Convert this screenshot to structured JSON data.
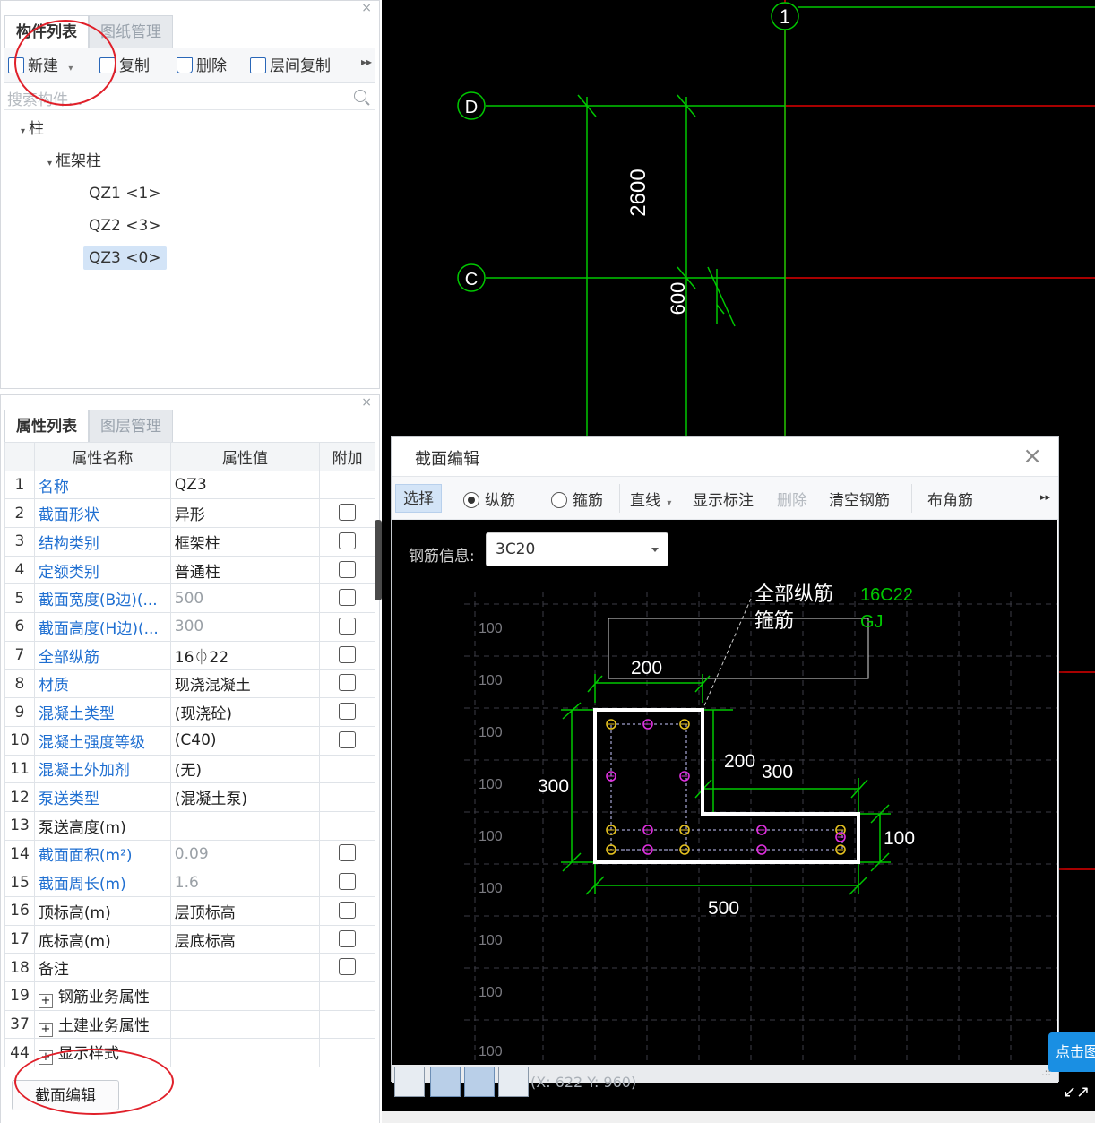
{
  "component_panel": {
    "close_glyph": "×",
    "tabs": [
      "构件列表",
      "图纸管理"
    ],
    "toolbar": {
      "new_label": "新建",
      "new_dropdown": "▾",
      "copy_label": "复制",
      "delete_label": "删除",
      "floor_copy_label": "层间复制",
      "more_glyph": "▸▸"
    },
    "search_placeholder": "搜索构件...",
    "tree": {
      "root": "柱",
      "group": "框架柱",
      "items": [
        "QZ1 <1>",
        "QZ2 <3>",
        "QZ3 <0>"
      ],
      "selected_index": 2
    }
  },
  "property_panel": {
    "close_glyph": "×",
    "tabs": [
      "属性列表",
      "图层管理"
    ],
    "headers": [
      "属性名称",
      "属性值",
      "附加"
    ],
    "rows": [
      {
        "num": "1",
        "name": "名称",
        "value": "QZ3",
        "name_style": "blue",
        "value_style": "normal",
        "checkbox": false
      },
      {
        "num": "2",
        "name": "截面形状",
        "value": "异形",
        "name_style": "blue",
        "value_style": "normal",
        "checkbox": true
      },
      {
        "num": "3",
        "name": "结构类别",
        "value": "框架柱",
        "name_style": "blue",
        "value_style": "normal",
        "checkbox": true
      },
      {
        "num": "4",
        "name": "定额类别",
        "value": "普通柱",
        "name_style": "blue",
        "value_style": "normal",
        "checkbox": true
      },
      {
        "num": "5",
        "name": "截面宽度(B边)(...",
        "value": "500",
        "name_style": "blue",
        "value_style": "grey",
        "checkbox": true
      },
      {
        "num": "6",
        "name": "截面高度(H边)(...",
        "value": "300",
        "name_style": "blue",
        "value_style": "grey",
        "checkbox": true
      },
      {
        "num": "7",
        "name": "全部纵筋",
        "value": "16⏀22",
        "name_style": "blue",
        "value_style": "normal",
        "checkbox": true
      },
      {
        "num": "8",
        "name": "材质",
        "value": "现浇混凝土",
        "name_style": "blue",
        "value_style": "normal",
        "checkbox": true
      },
      {
        "num": "9",
        "name": "混凝土类型",
        "value": "(现浇砼)",
        "name_style": "blue",
        "value_style": "normal",
        "checkbox": true
      },
      {
        "num": "10",
        "name": "混凝土强度等级",
        "value": "(C40)",
        "name_style": "blue",
        "value_style": "normal",
        "checkbox": true
      },
      {
        "num": "11",
        "name": "混凝土外加剂",
        "value": "(无)",
        "name_style": "blue",
        "value_style": "normal",
        "checkbox": false
      },
      {
        "num": "12",
        "name": "泵送类型",
        "value": "(混凝土泵)",
        "name_style": "blue",
        "value_style": "normal",
        "checkbox": false
      },
      {
        "num": "13",
        "name": "泵送高度(m)",
        "value": "",
        "name_style": "normal",
        "value_style": "normal",
        "checkbox": false
      },
      {
        "num": "14",
        "name": "截面面积(m²)",
        "value": "0.09",
        "name_style": "blue",
        "value_style": "grey",
        "checkbox": true
      },
      {
        "num": "15",
        "name": "截面周长(m)",
        "value": "1.6",
        "name_style": "blue",
        "value_style": "grey",
        "checkbox": true
      },
      {
        "num": "16",
        "name": "顶标高(m)",
        "value": "层顶标高",
        "name_style": "normal",
        "value_style": "normal",
        "checkbox": true
      },
      {
        "num": "17",
        "name": "底标高(m)",
        "value": "层底标高",
        "name_style": "normal",
        "value_style": "normal",
        "checkbox": true
      },
      {
        "num": "18",
        "name": "备注",
        "value": "",
        "name_style": "normal",
        "value_style": "normal",
        "checkbox": true
      }
    ],
    "groups": [
      {
        "num": "19",
        "label": "钢筋业务属性"
      },
      {
        "num": "37",
        "label": "土建业务属性"
      },
      {
        "num": "44",
        "label": "显示样式"
      }
    ],
    "section_edit_button": "截面编辑",
    "plus_glyph": "+"
  },
  "cad": {
    "axis_labels": [
      "1",
      "D",
      "C"
    ],
    "dimensions": [
      "2600",
      "600"
    ]
  },
  "dialog": {
    "title": "截面编辑",
    "close_glyph": "×",
    "tools": {
      "select": "选择",
      "longitudinal": "纵筋",
      "stirrup": "箍筋",
      "line": "直线",
      "line_dropdown": "▾",
      "show_dim": "显示标注",
      "delete": "删除",
      "clear": "清空钢筋",
      "corner": "布角筋",
      "more": "▸▸"
    },
    "rebar_info_label": "钢筋信息:",
    "rebar_info_value": "3C20",
    "drawing": {
      "label_all_long": "全部纵筋",
      "label_all_long_value": "16C22",
      "label_stirrup": "箍筋",
      "label_stirrup_value": "GJ",
      "grid_label": "100",
      "dim_top": "200",
      "dim_left": "300",
      "dim_inner_v": "200",
      "dim_inner_h": "300",
      "dim_right": "100",
      "dim_bottom": "500"
    },
    "coordinates": "(X: 622 Y: 960)",
    "foot_grip": ".::"
  },
  "side_tip": "点击图",
  "resize_glyph": "↙↗",
  "colors": {
    "cad_bg": "#000000",
    "axis_green": "#00c800",
    "axis_red": "#e00000",
    "rebar_yellow": "#e6c220",
    "rebar_magenta": "#e030e0",
    "accent_blue": "#1f6fd1"
  }
}
